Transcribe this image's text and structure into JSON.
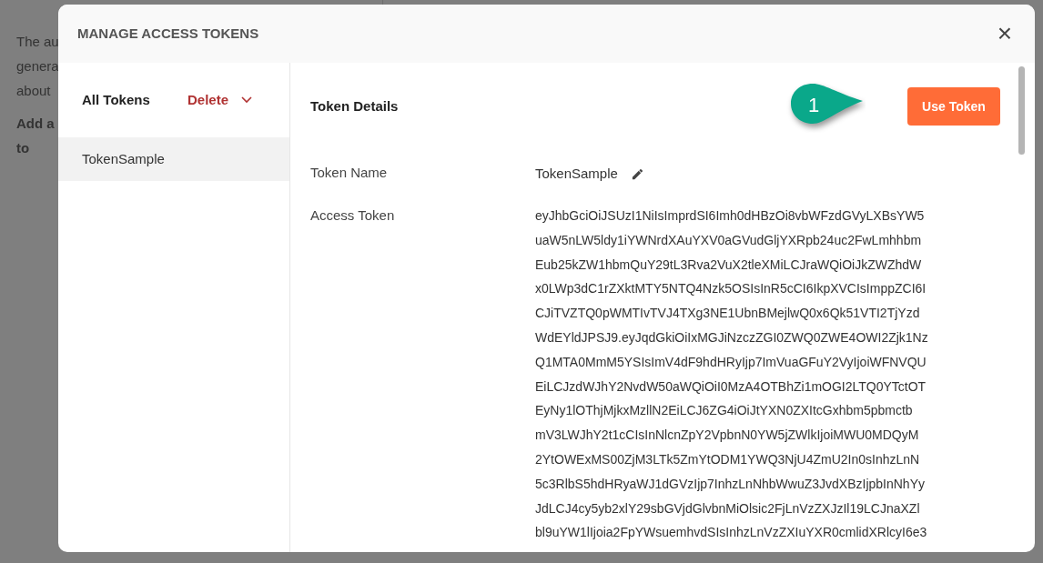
{
  "background_page": {
    "lines": [
      {
        "text": "The au",
        "bold": false
      },
      {
        "text": "genera",
        "bold": false
      },
      {
        "text": "about",
        "bold": false
      },
      {
        "text": "Add a",
        "bold": true
      },
      {
        "text": "to",
        "bold": true
      }
    ]
  },
  "dialog": {
    "title": "MANAGE ACCESS TOKENS",
    "close": "×",
    "sidebar": {
      "heading": "All Tokens",
      "delete": "Delete",
      "items": [
        {
          "label": "TokenSample",
          "selected": true
        }
      ]
    },
    "details": {
      "heading": "Token Details",
      "callout": "1",
      "use_button": "Use Token",
      "fields": [
        {
          "kind": "editable",
          "label": "Token Name",
          "value": "TokenSample"
        },
        {
          "kind": "token",
          "label": "Access Token",
          "lines": [
            "eyJhbGciOiJSUzI1NiIsImprdSI6Imh0dHBzOi8vbWFzdGVyLXBsYW5",
            "uaW5nLW5ldy1iYWNrdXAuYXV0aGVudGljYXRpb24uc2FwLmhhbm",
            "Eub25kZW1hbmQuY29tL3Rva2VuX2tleXMiLCJraWQiOiJkZWZhdW",
            "x0LWp3dC1rZXktMTY5NTQ4Nzk5OSIsInR5cCI6IkpXVCIsImppZCI6I",
            "CJiTVZTQ0pWMTIvTVJ4TXg3NE1UbnBMejlwQ0x6Qk51VTI2TjYzd",
            "WdEYldJPSJ9.eyJqdGkiOiIxMGJiNzczZGI0ZWQ0ZWE4OWI2Zjk1Nz",
            "Q1MTA0MmM5YSIsImV4dF9hdHRyIjp7ImVuaGFuY2VyIjoiWFNVQU",
            "EiLCJzdWJhY2NvdW50aWQiOiI0MzA4OTBhZi1mOGI2LTQ0YTctOT",
            "EyNy1lOThjMjkxMzllN2EiLCJ6ZG4iOiJtYXN0ZXItcGxhbm5pbmctb",
            "mV3LWJhY2t1cCIsInNlcnZpY2VpbnN0YW5jZWlkIjoiMWU0MDQyM",
            "2YtOWExMS00ZjM3LTk5ZmYtODM1YWQ3NjU4ZmU2In0sInhzLnN",
            "5c3RlbS5hdHRyaWJ1dGVzIjp7InhzLnNhbWwuZ3JvdXBzIjpbInNhYy",
            "JdLCJ4cy5yb2xlY29sbGVjdGlvbnMiOlsic2FjLnVzZXJzIl19LCJnaXZl",
            "bl9uYW1lIjoia2FpYWsuemhvdSIsInhzLnVzZXIuYXR0cmlidXRlcyI6e3"
          ]
        }
      ]
    }
  }
}
